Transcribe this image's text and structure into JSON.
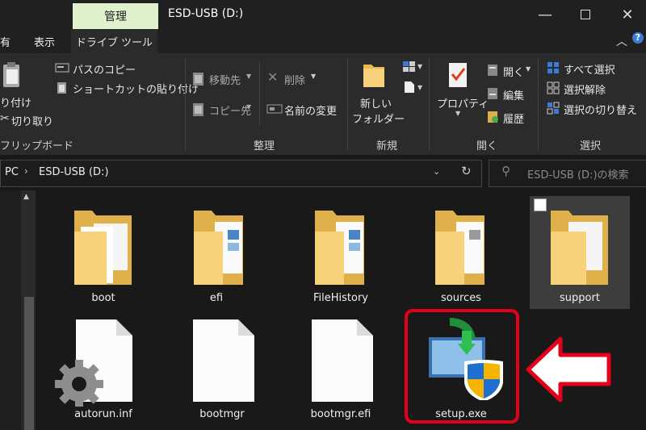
{
  "window": {
    "context_tab": "管理",
    "title": "ESD-USB (D:)"
  },
  "menu": {
    "file_partial": "有",
    "view": "表示",
    "drive_tools": "ドライブ ツール"
  },
  "ribbon": {
    "clipboard": {
      "paste_partial": "り付け",
      "copy_path": "パスのコピー",
      "paste_shortcut": "ショートカットの貼り付け",
      "cut": "切り取り",
      "group": "フリップボード"
    },
    "organize": {
      "move_to": "移動先",
      "copy_to": "コピー先",
      "delete": "削除",
      "rename": "名前の変更",
      "group": "整理"
    },
    "new": {
      "new_folder_line1": "新しい",
      "new_folder_line2": "フォルダー",
      "group": "新規"
    },
    "open": {
      "properties": "プロパティ",
      "open": "開く",
      "edit": "編集",
      "history": "履歴",
      "group": "開く"
    },
    "select": {
      "select_all": "すべて選択",
      "select_none": "選択解除",
      "invert": "選択の切り替え",
      "group": "選択"
    }
  },
  "address": {
    "pc": "PC",
    "drive": "ESD-USB (D:)",
    "search_placeholder": "ESD-USB (D:)の検索"
  },
  "items": [
    {
      "name": "boot",
      "type": "folder"
    },
    {
      "name": "efi",
      "type": "folder"
    },
    {
      "name": "FileHistory",
      "type": "folder"
    },
    {
      "name": "sources",
      "type": "folder"
    },
    {
      "name": "support",
      "type": "folder"
    },
    {
      "name": "autorun.inf",
      "type": "settings-file"
    },
    {
      "name": "bootmgr",
      "type": "file"
    },
    {
      "name": "bootmgr.efi",
      "type": "file"
    },
    {
      "name": "setup.exe",
      "type": "setup-exe"
    }
  ],
  "colors": {
    "highlight": "#e3001b",
    "folder": "#f7d27b",
    "context_tab": "#dff2cd"
  }
}
